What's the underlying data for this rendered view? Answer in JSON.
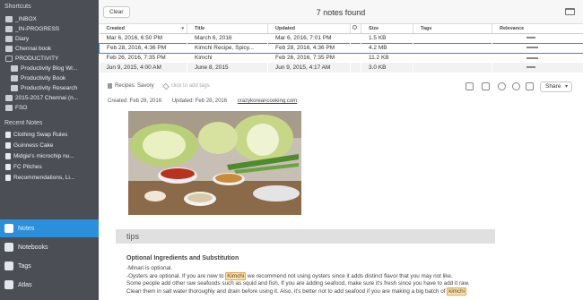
{
  "sidebar": {
    "shortcuts_heading": "Shortcuts",
    "shortcuts": [
      {
        "label": "_INBOX",
        "icon": "notebook-icon",
        "indent": 1
      },
      {
        "label": "_IN-PROGRESS",
        "icon": "notebook-icon",
        "indent": 1
      },
      {
        "label": "Diary",
        "icon": "notebook-icon",
        "indent": 1
      },
      {
        "label": "Chennai book",
        "icon": "notebook-icon",
        "indent": 1
      },
      {
        "label": "PRODUCTIVITY",
        "icon": "stack-icon",
        "indent": 1
      },
      {
        "label": "Productivity Blog Wr...",
        "icon": "notebook-icon",
        "indent": 2
      },
      {
        "label": "Productivity Book",
        "icon": "notebook-icon",
        "indent": 2
      },
      {
        "label": "Productivity Research",
        "icon": "notebook-icon",
        "indent": 2
      },
      {
        "label": "2015-2017 Chennai (n...",
        "icon": "notebook-icon",
        "indent": 1
      },
      {
        "label": "FSO",
        "icon": "notebook-icon",
        "indent": 1
      }
    ],
    "recent_heading": "Recent Notes",
    "recent": [
      {
        "label": "Clothing Swap Rules"
      },
      {
        "label": "Guinness Cake"
      },
      {
        "label": "Midgie's microchip nu..."
      },
      {
        "label": "FC Pitches"
      },
      {
        "label": "Recommendations, Li..."
      }
    ],
    "nav": [
      {
        "label": "Notes",
        "icon": "notes-icon",
        "active": true
      },
      {
        "label": "Notebooks",
        "icon": "notebooks-icon",
        "active": false
      },
      {
        "label": "Tags",
        "icon": "tag-icon",
        "active": false
      },
      {
        "label": "Atlas",
        "icon": "atlas-icon",
        "active": false
      }
    ]
  },
  "toolbar": {
    "clear_label": "Clear",
    "notes_found": "7 notes found"
  },
  "table": {
    "columns": [
      "Created",
      "Title",
      "Updated",
      "",
      "Size",
      "Tags",
      "Relevance"
    ],
    "rows": [
      {
        "created": "Mar 6, 2016, 6:50 PM",
        "title": "March 6, 2016",
        "updated": "Mar 6, 2016, 7:01 PM",
        "size": "1.5 KB",
        "tags": "",
        "relevance": 0.6
      },
      {
        "created": "Feb 28, 2016, 4:36 PM",
        "title": "Kimchi Recipe, Spicy...",
        "updated": "Feb 28, 2016, 4:36 PM",
        "size": "4.2 MB",
        "tags": "",
        "relevance": 0.8,
        "selected": true
      },
      {
        "created": "Feb 26, 2016, 7:35 PM",
        "title": "Kimchi",
        "updated": "Feb 26, 2016, 7:35 PM",
        "size": "11.2 KB",
        "tags": "",
        "relevance": 0.8
      },
      {
        "created": "Jun 9, 2015, 4:00 AM",
        "title": "June 8, 2015",
        "updated": "Jun 9, 2015, 4:17 AM",
        "size": "3.0 KB",
        "tags": "",
        "relevance": 0.6
      }
    ]
  },
  "note": {
    "notebook": "Recipes: Savory",
    "add_tags_placeholder": "click to add tags",
    "share_label": "Share",
    "created": "Created: Feb 28, 2016",
    "updated": "Updated: Feb 28, 2016",
    "source_url": "crazykoreancooking.com",
    "section_title": "tips",
    "content_heading": "Optional Ingredients and Substitution",
    "lines": {
      "l1": "-Minari is optional.",
      "l2_pre": "-Oysters are optional. If you are new to ",
      "l2_hl": "Kimchi",
      "l2_post": " we recommend not using oysters since it adds distinct flavor that you may not like.",
      "l3": "Some people add other raw seafoods such as squid and fish. If you are adding seafood, make sure it's fresh since you have to add it raw.",
      "l4_pre": "Clean them in salt water thoroughly and drain before using it. Also, it's better not to add seafood if you are making a big batch of ",
      "l4_hl": "kimchi"
    }
  },
  "colors": {
    "sidebar_bg": "#4b4f55",
    "active_nav": "#2b8fdb",
    "highlight": "#fce3a6"
  }
}
